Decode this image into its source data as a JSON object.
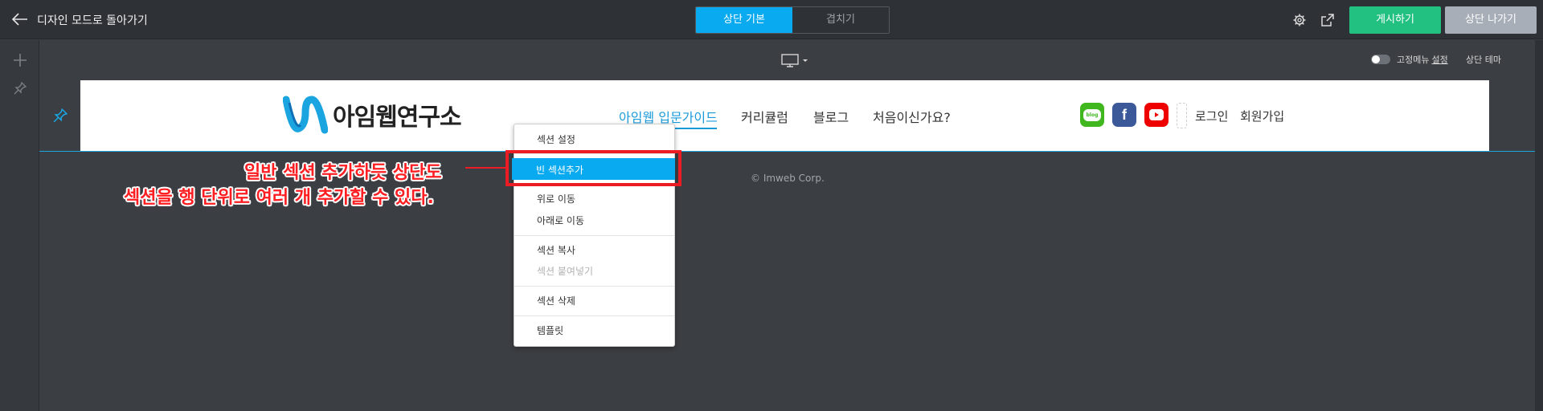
{
  "topbar": {
    "back_label": "디자인 모드로 돌아가기",
    "tabs": [
      {
        "label": "상단 기본",
        "active": true
      },
      {
        "label": "겹치기",
        "active": false
      }
    ],
    "icons": [
      "gear-icon",
      "external-link-icon"
    ],
    "publish_label": "게시하기",
    "exit_label": "상단 나가기",
    "colors": {
      "accent": "#0aaaf0",
      "publish": "#22c181",
      "exit": "#a7aeb8"
    }
  },
  "leftrail": {
    "icons": [
      "plus-icon",
      "pin-icon"
    ]
  },
  "subtoolbar": {
    "device_icon": "desktop-icon",
    "fixmenu_label": "고정메뉴",
    "fixmenu_link": "설정",
    "header_theme": "상단 테마"
  },
  "site_header": {
    "logo_text": "아임웹연구소",
    "nav": [
      "아임웹 입문가이드",
      "커리큘럼",
      "블로그",
      "처음이신가요?"
    ],
    "active_nav": 0,
    "social": [
      "blog-icon",
      "facebook-icon",
      "youtube-icon"
    ],
    "blog_text": "blog",
    "login": "로그인",
    "signup": "회원가입"
  },
  "footer": {
    "copyright": "© Imweb Corp."
  },
  "context_menu": {
    "items": [
      {
        "label": "섹션 설정",
        "disabled": false
      },
      {
        "label": "빈 섹션추가",
        "disabled": false,
        "highlighted": true
      },
      {
        "label": "위로 이동",
        "disabled": false
      },
      {
        "label": "아래로 이동",
        "disabled": false
      },
      {
        "label": "섹션 복사",
        "disabled": false
      },
      {
        "label": "섹션 붙여넣기",
        "disabled": true
      },
      {
        "label": "섹션 삭제",
        "disabled": false
      },
      {
        "label": "템플릿",
        "disabled": false
      }
    ]
  },
  "annotation": {
    "line1": "일반 섹션 추가하듯 상단도",
    "line2": "섹션을 행 단위로 여러 개 추가할 수 있다."
  }
}
